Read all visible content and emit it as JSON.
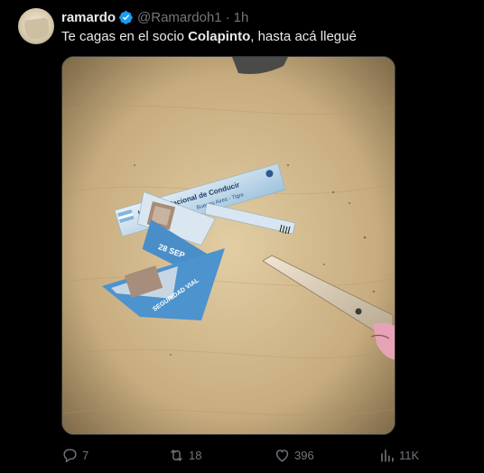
{
  "tweet": {
    "display_name": "ramardo",
    "handle": "@Ramardoh1",
    "separator": "·",
    "time": "1h",
    "text_before": "Te cagas en el socio ",
    "text_bold": "Colapinto",
    "text_after": ", hasta acá llegué"
  },
  "media": {
    "card_text_main": "Licencia Nacional de Conducir",
    "card_text_sub": "Buenos Aires - Tigre",
    "card_text_date": "28 SEP",
    "card_text_vial": "SEGURIDAD VIAL"
  },
  "actions": {
    "replies": "7",
    "retweets": "18",
    "likes": "396",
    "views": "11K"
  },
  "colors": {
    "background": "#000000",
    "text": "#e7e9ea",
    "muted": "#71767b",
    "verified": "#1d9bf0"
  }
}
